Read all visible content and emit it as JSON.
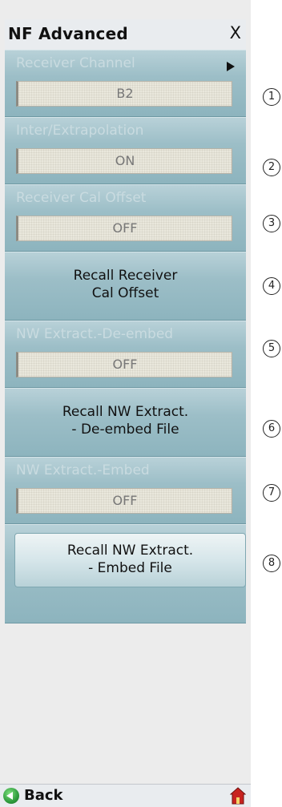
{
  "panel": {
    "title": "NF Advanced",
    "close_label": "X"
  },
  "items": [
    {
      "label": "Receiver Channel",
      "value": "B2",
      "callout": "1"
    },
    {
      "label": "Inter/Extrapolation",
      "value": "ON",
      "callout": "2"
    },
    {
      "label": "Receiver Cal Offset",
      "value": "OFF",
      "callout": "3"
    },
    {
      "line1": "Recall Receiver",
      "line2": "Cal Offset",
      "callout": "4"
    },
    {
      "label": "NW Extract.-De-embed",
      "value": "OFF",
      "callout": "5"
    },
    {
      "line1": "Recall NW Extract.",
      "line2": "- De-embed File",
      "callout": "6"
    },
    {
      "label": "NW Extract.-Embed",
      "value": "OFF",
      "callout": "7"
    },
    {
      "line1": "Recall NW Extract.",
      "line2": "- Embed File",
      "callout": "8"
    }
  ],
  "footer": {
    "back_label": "Back",
    "back_icon": "back-arrow-icon",
    "home_icon": "home-icon"
  },
  "colors": {
    "menu_teal": "#8fb5bf",
    "disabled_text": "#c9dbe0",
    "field_bg": "#e9e7dc"
  }
}
